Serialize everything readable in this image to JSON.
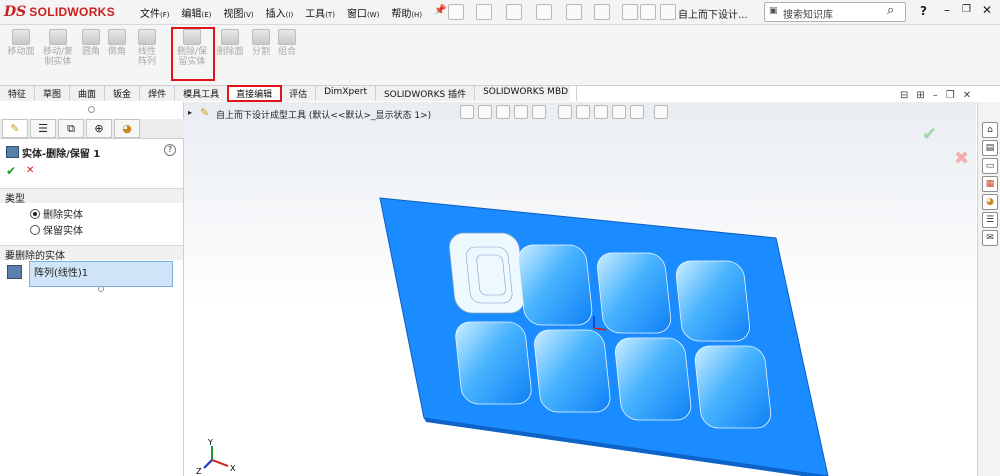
{
  "app": {
    "logo_ds": "DS",
    "logo_text": "SOLIDWORKS"
  },
  "menu": {
    "items": [
      {
        "label": "文件",
        "accel": "(F)"
      },
      {
        "label": "编辑",
        "accel": "(E)"
      },
      {
        "label": "视图",
        "accel": "(V)"
      },
      {
        "label": "插入",
        "accel": "(I)"
      },
      {
        "label": "工具",
        "accel": "(T)"
      },
      {
        "label": "窗口",
        "accel": "(W)"
      },
      {
        "label": "帮助",
        "accel": "(H)"
      }
    ],
    "doc_title": "自上而下设计...",
    "search_placeholder": "搜索知识库",
    "help": "?"
  },
  "ribbon": {
    "buttons": [
      {
        "label": "移动面",
        "icon": "move-face-icon"
      },
      {
        "label": "移动/复制实体",
        "icon": "move-copy-body-icon"
      },
      {
        "label": "圆角",
        "icon": "fillet-icon"
      },
      {
        "label": "倒角",
        "icon": "chamfer-icon"
      },
      {
        "label": "线性阵列",
        "icon": "linear-pattern-icon"
      },
      {
        "label": "删除/保留实体",
        "icon": "delete-keep-body-icon"
      },
      {
        "label": "删除面",
        "icon": "delete-face-icon"
      },
      {
        "label": "分割",
        "icon": "split-icon"
      },
      {
        "label": "组合",
        "icon": "combine-icon"
      }
    ]
  },
  "tabs": [
    {
      "label": "特征"
    },
    {
      "label": "草图"
    },
    {
      "label": "曲面"
    },
    {
      "label": "钣金"
    },
    {
      "label": "焊件"
    },
    {
      "label": "模具工具"
    },
    {
      "label": "直接编辑",
      "highlighted": true
    },
    {
      "label": "评估"
    },
    {
      "label": "DimXpert"
    },
    {
      "label": "SOLIDWORKS 插件"
    },
    {
      "label": "SOLIDWORKS MBD"
    }
  ],
  "panel": {
    "title": "实体-删除/保留 1",
    "ok": "✔",
    "cancel": "✕",
    "type_section": "类型",
    "option_delete": "删除实体",
    "option_keep": "保留实体",
    "selected_option": "删除实体",
    "bodies_section": "要删除的实体",
    "selected_body": "阵列(线性)1"
  },
  "viewport": {
    "tree_label": "自上而下设计成型工具 (默认<<默认>_显示状态 1>)",
    "confirm_ok": "✔",
    "confirm_cancel": "✖",
    "axis_x": "X",
    "axis_y": "Y",
    "axis_z": "Z"
  },
  "colors": {
    "accent_red": "#e0141a",
    "model_blue": "#1a8cff",
    "brand_red": "#c8201e"
  }
}
